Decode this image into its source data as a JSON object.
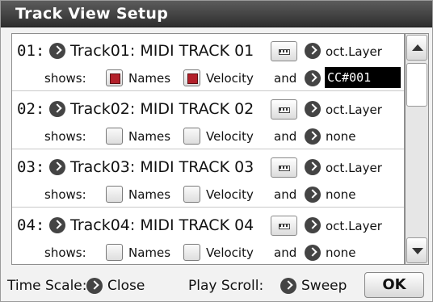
{
  "dialog": {
    "title": "Track View Setup"
  },
  "tracks": [
    {
      "num": "01:",
      "name": "Track01: MIDI TRACK 01",
      "layer": "oct.Layer",
      "shows": "shows:",
      "names_label": "Names",
      "names_checked": true,
      "velocity_label": "Velocity",
      "velocity_checked": true,
      "and_label": "and",
      "cc": "CC#001"
    },
    {
      "num": "02:",
      "name": "Track02: MIDI TRACK 02",
      "layer": "oct.Layer",
      "shows": "shows:",
      "names_label": "Names",
      "names_checked": false,
      "velocity_label": "Velocity",
      "velocity_checked": false,
      "and_label": "and",
      "cc": "none"
    },
    {
      "num": "03:",
      "name": "Track03: MIDI TRACK 03",
      "layer": "oct.Layer",
      "shows": "shows:",
      "names_label": "Names",
      "names_checked": false,
      "velocity_label": "Velocity",
      "velocity_checked": false,
      "and_label": "and",
      "cc": "none"
    },
    {
      "num": "04:",
      "name": "Track04: MIDI TRACK 04",
      "layer": "oct.Layer",
      "shows": "shows:",
      "names_label": "Names",
      "names_checked": false,
      "velocity_label": "Velocity",
      "velocity_checked": false,
      "and_label": "and",
      "cc": "none"
    }
  ],
  "footer": {
    "time_scale_label": "Time Scale:",
    "time_scale_value": "Close",
    "play_scroll_label": "Play Scroll:",
    "play_scroll_value": "Sweep",
    "ok_label": "OK"
  },
  "colors": {
    "titlebar": "#3a3a3a",
    "checked": "#b3202a",
    "selected_bg": "#000000"
  }
}
